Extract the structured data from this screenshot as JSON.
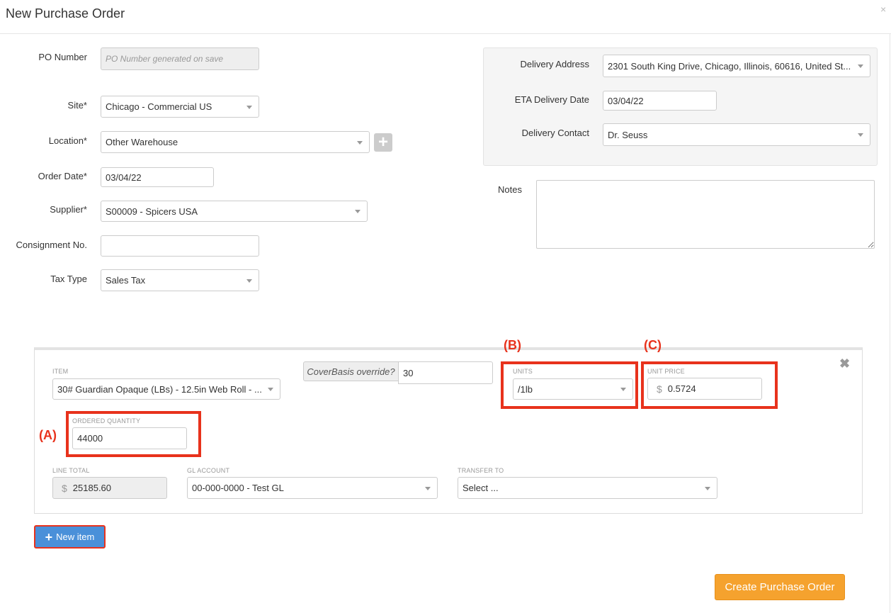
{
  "modal": {
    "title": "New Purchase Order",
    "close_symbol": "×"
  },
  "form": {
    "po_number": {
      "label": "PO Number",
      "placeholder": "PO Number generated on save"
    },
    "site": {
      "label": "Site*",
      "value": "Chicago - Commercial US"
    },
    "location": {
      "label": "Location*",
      "value": "Other Warehouse"
    },
    "order_date": {
      "label": "Order Date*",
      "value": "03/04/22"
    },
    "supplier": {
      "label": "Supplier*",
      "value": "S00009 - Spicers USA"
    },
    "consignment": {
      "label": "Consignment No.",
      "value": ""
    },
    "tax_type": {
      "label": "Tax Type",
      "value": "Sales Tax"
    }
  },
  "delivery": {
    "address": {
      "label": "Delivery Address",
      "value": "2301 South King Drive, Chicago, Illinois, 60616, United St..."
    },
    "eta": {
      "label": "ETA Delivery Date",
      "value": "03/04/22"
    },
    "contact": {
      "label": "Delivery Contact",
      "value": "Dr. Seuss"
    }
  },
  "notes": {
    "label": "Notes",
    "value": ""
  },
  "line_item": {
    "item": {
      "label": "ITEM",
      "value": "30# Guardian Opaque (LBs) - 12.5in Web Roll - ..."
    },
    "coverbasis": {
      "label": "CoverBasis override?",
      "value": "30"
    },
    "units": {
      "label": "UNITS",
      "value": "/1lb"
    },
    "unit_price": {
      "label": "UNIT PRICE",
      "currency": "$",
      "value": "0.5724"
    },
    "ordered_quantity": {
      "label": "ORDERED QUANTITY",
      "value": "44000"
    },
    "line_total": {
      "label": "LINE TOTAL",
      "currency": "$",
      "value": "25185.60"
    },
    "gl_account": {
      "label": "GL ACCOUNT",
      "value": "00-000-0000 - Test GL"
    },
    "transfer_to": {
      "label": "TRANSFER TO",
      "value": "Select ..."
    },
    "remove_symbol": "✖"
  },
  "annotations": {
    "a": "(A)",
    "b": "(B)",
    "c": "(C)",
    "color": "#e8321c"
  },
  "buttons": {
    "add_location": "+",
    "new_item": "New item",
    "new_item_icon": "+",
    "create": "Create Purchase Order"
  },
  "colors": {
    "primary": "#4a90d9",
    "create": "#f5a22e",
    "highlight": "#e8321c"
  }
}
